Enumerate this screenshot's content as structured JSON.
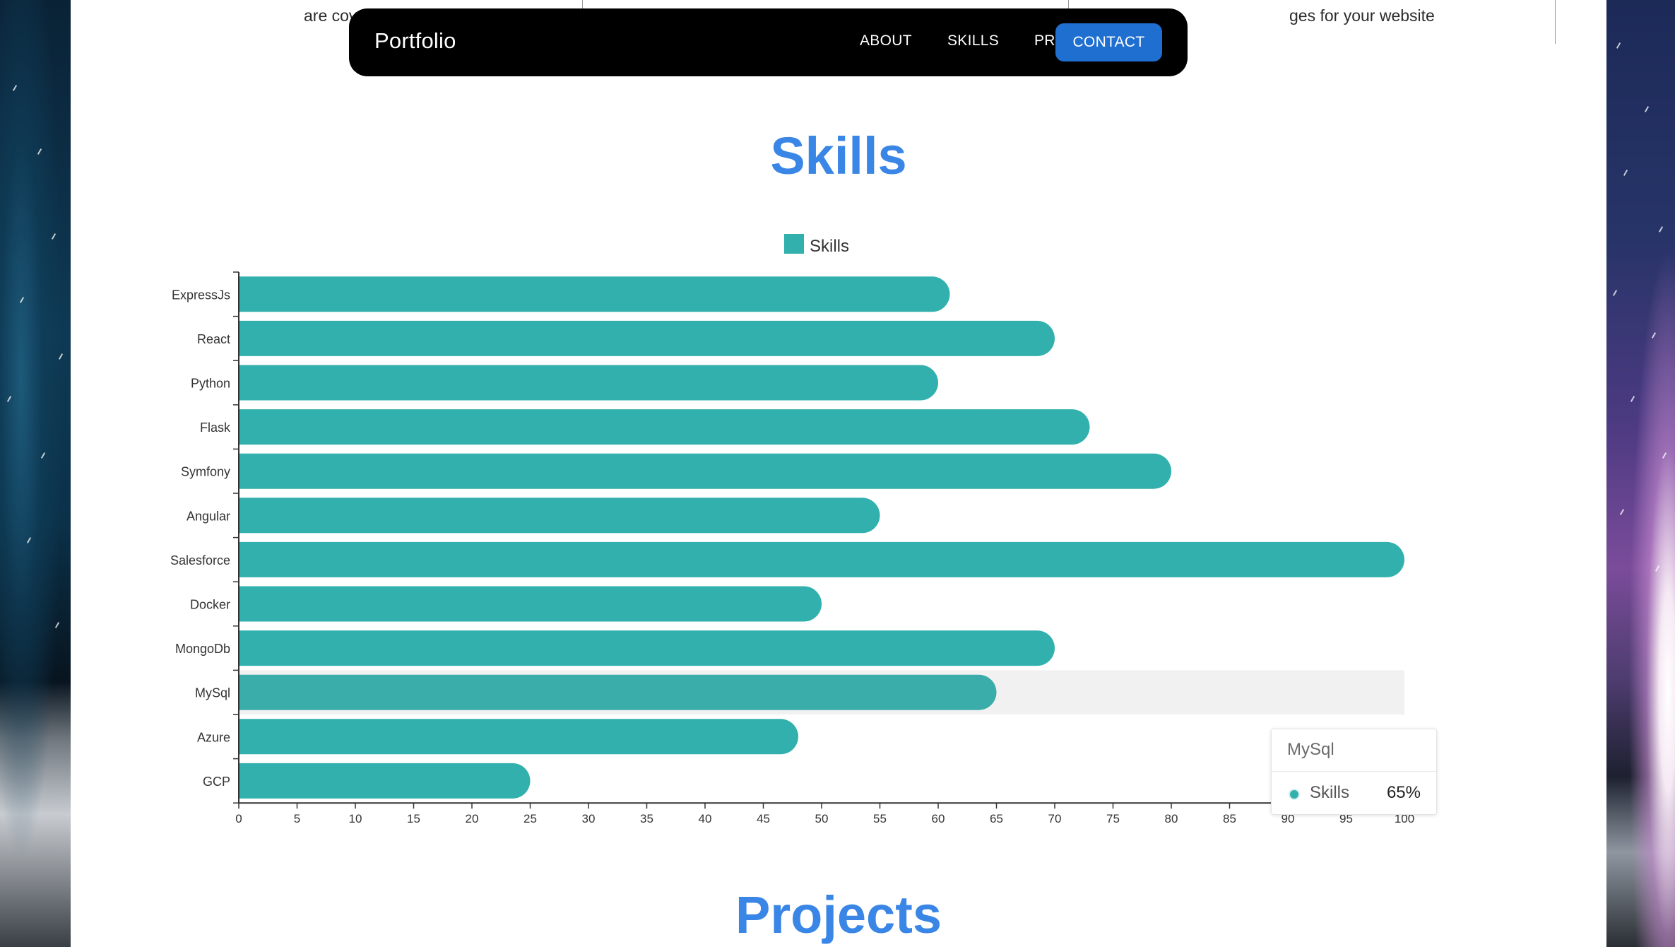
{
  "top_cards": {
    "left_text": "are covered.",
    "right_text": "ges for your website"
  },
  "navbar": {
    "brand": "Portfolio",
    "items": [
      {
        "label": "ABOUT"
      },
      {
        "label": "SKILLS"
      },
      {
        "label": "PROJECTS"
      }
    ],
    "contact_label": "CONTACT"
  },
  "skills_section": {
    "title": "Skills"
  },
  "projects_section": {
    "title": "Projects"
  },
  "colors": {
    "bar": "#32b0ad",
    "bar_hover": "#3aaca9",
    "heading": "#3a86e6",
    "contact_button": "#1f6fd1"
  },
  "chart_data": {
    "type": "bar",
    "orientation": "horizontal",
    "categories": [
      "ExpressJs",
      "React",
      "Python",
      "Flask",
      "Symfony",
      "Angular",
      "Salesforce",
      "Docker",
      "MongoDb",
      "MySql",
      "Azure",
      "GCP"
    ],
    "series": [
      {
        "name": "Skills",
        "values": [
          61,
          70,
          60,
          73,
          80,
          55,
          100,
          50,
          70,
          65,
          48,
          25
        ]
      }
    ],
    "xlim": [
      0,
      100
    ],
    "x_ticks": [
      0,
      5,
      10,
      15,
      20,
      25,
      30,
      35,
      40,
      45,
      50,
      55,
      60,
      65,
      70,
      75,
      80,
      85,
      90,
      95,
      100
    ],
    "legend": "top-center",
    "grid": false,
    "highlighted_category": "MySql"
  },
  "tooltip": {
    "title": "MySql",
    "series_label": "Skills",
    "value": "65%"
  }
}
